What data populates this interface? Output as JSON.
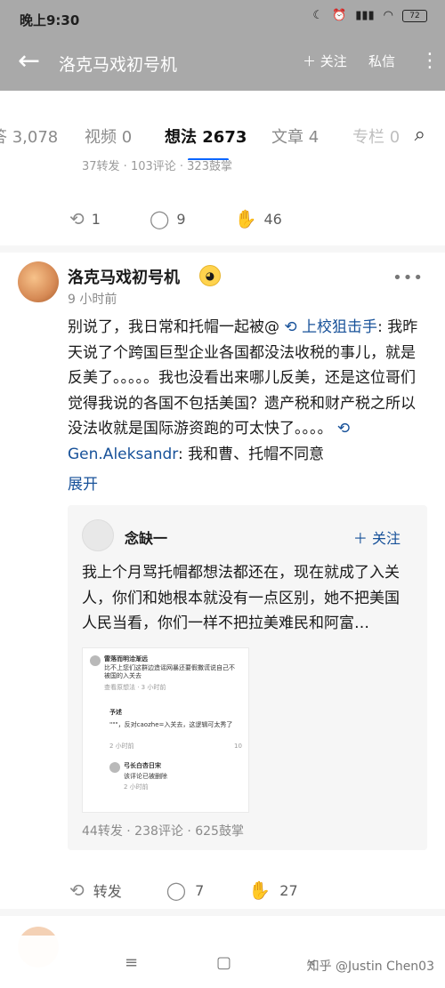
{
  "status": {
    "time": "晚上9:30",
    "icons": [
      "moon-icon",
      "alarm-icon",
      "hd-signal-icon",
      "wifi-icon"
    ],
    "battery": "72"
  },
  "header": {
    "title": "洛克马戏初号机",
    "follow": "＋ 关注",
    "message": "私信"
  },
  "tabs": [
    "答 3,078",
    "视频 0",
    "想法 2673",
    "文章 4",
    "专栏 0"
  ],
  "card1": {
    "stats": "37转发 · 103评论 · 323鼓掌",
    "repost": "1",
    "comment": "9",
    "clap": "46"
  },
  "post": {
    "author": "洛克马戏初号机",
    "time": "9 小时前",
    "text_a": "别说了，我日常和托帽一起被@ ",
    "mention1": "上校狙击手",
    "text_b": ": 我昨天说了个跨国巨型企业各国都没法收税的事儿，就是反美了。。。。。我也没看出来哪儿反美，还是这位哥们觉得我说的各国不包括美国？遗产税和财产税之所以没法收就是国际游资跑的可太快了。。。。 ",
    "mention2": "Gen.Aleksandr",
    "text_c": ": 我和曹、托帽不同意",
    "expand": "展开",
    "quote": {
      "author": "念缺一",
      "follow": "＋ 关注",
      "text": "我上个月骂托帽都想法都还在，现在就成了入关人，你们和她根本就没有一点区别，她不把美国人民当看，你们一样不把拉美难民和阿富…",
      "image": {
        "u1": "雷落而明洽渐远",
        "t1": "比不上您们这群边造谣网暴还要假撒谎说自己不被国的入关去",
        "m1": "查看原想法 · 3 小时前",
        "u2": "予述",
        "t2": "\"\"\"，反对caozhe=入关去，这逻辑可太秀了",
        "m2": "2 小时前",
        "n2": "10",
        "u3": "弓长白杏日宋",
        "t3": "该评论已被删除",
        "m3": "2 小时前"
      },
      "stats": "44转发 · 238评论 · 625鼓掌"
    },
    "actions": {
      "repost": "转发",
      "comment": "7",
      "clap": "27"
    }
  },
  "watermark": "知乎 @Justin Chen03"
}
